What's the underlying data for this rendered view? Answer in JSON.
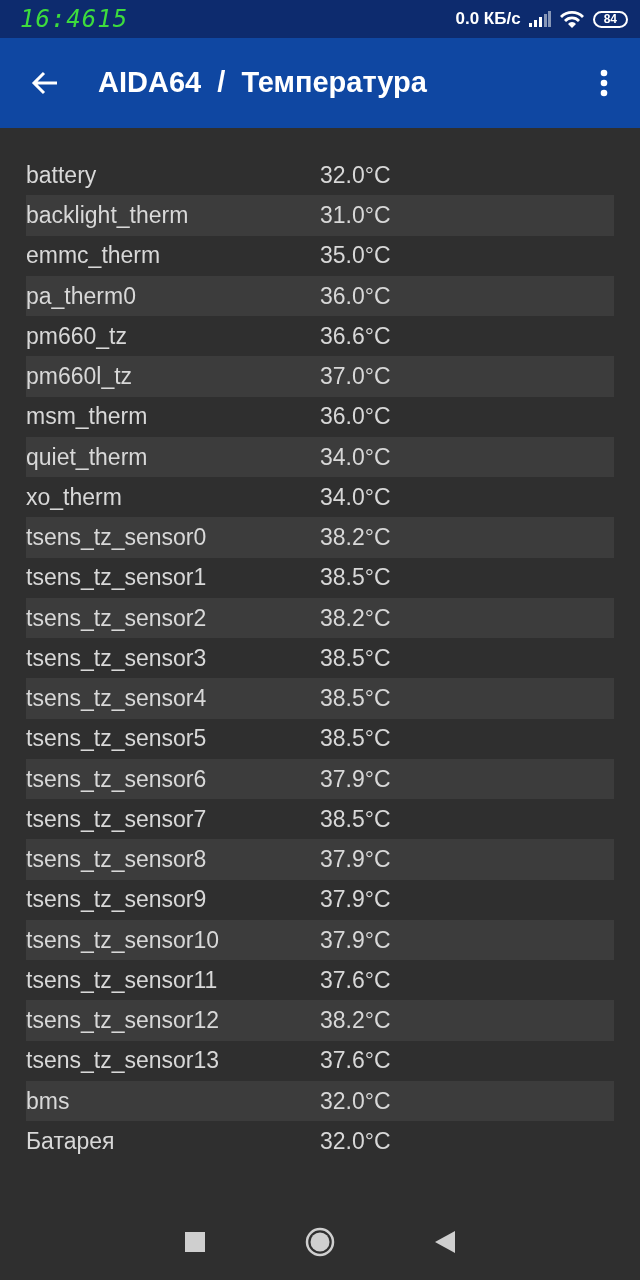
{
  "status_bar": {
    "time": "16:4615",
    "speed": "0.0 КБ/с",
    "battery": "84"
  },
  "app_bar": {
    "title": "AIDA64  /  Температура"
  },
  "sensors": [
    {
      "name": "battery",
      "value": "32.0°C"
    },
    {
      "name": "backlight_therm",
      "value": "31.0°C"
    },
    {
      "name": "emmc_therm",
      "value": "35.0°C"
    },
    {
      "name": "pa_therm0",
      "value": "36.0°C"
    },
    {
      "name": "pm660_tz",
      "value": "36.6°C"
    },
    {
      "name": "pm660l_tz",
      "value": "37.0°C"
    },
    {
      "name": "msm_therm",
      "value": "36.0°C"
    },
    {
      "name": "quiet_therm",
      "value": "34.0°C"
    },
    {
      "name": "xo_therm",
      "value": "34.0°C"
    },
    {
      "name": "tsens_tz_sensor0",
      "value": "38.2°C"
    },
    {
      "name": "tsens_tz_sensor1",
      "value": "38.5°C"
    },
    {
      "name": "tsens_tz_sensor2",
      "value": "38.2°C"
    },
    {
      "name": "tsens_tz_sensor3",
      "value": "38.5°C"
    },
    {
      "name": "tsens_tz_sensor4",
      "value": "38.5°C"
    },
    {
      "name": "tsens_tz_sensor5",
      "value": "38.5°C"
    },
    {
      "name": "tsens_tz_sensor6",
      "value": "37.9°C"
    },
    {
      "name": "tsens_tz_sensor7",
      "value": "38.5°C"
    },
    {
      "name": "tsens_tz_sensor8",
      "value": "37.9°C"
    },
    {
      "name": "tsens_tz_sensor9",
      "value": "37.9°C"
    },
    {
      "name": "tsens_tz_sensor10",
      "value": "37.9°C"
    },
    {
      "name": "tsens_tz_sensor11",
      "value": "37.6°C"
    },
    {
      "name": "tsens_tz_sensor12",
      "value": "38.2°C"
    },
    {
      "name": "tsens_tz_sensor13",
      "value": "37.6°C"
    },
    {
      "name": "bms",
      "value": "32.0°C"
    },
    {
      "name": "Батарея",
      "value": "32.0°C"
    }
  ]
}
